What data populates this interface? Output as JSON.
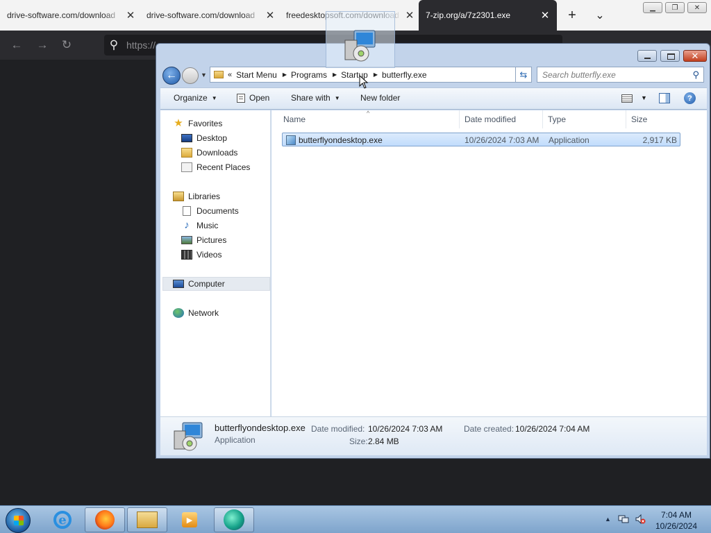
{
  "browser": {
    "tabs": [
      {
        "title": "drive-software.com/download",
        "active": false
      },
      {
        "title": "drive-software.com/download",
        "active": false
      },
      {
        "title": "freedesktopsoft.com/download",
        "active": false
      },
      {
        "title": "7-zip.org/a/7z2301.exe",
        "active": true
      }
    ],
    "new_tab_glyph": "+",
    "tab_list_glyph": "⌄",
    "url_partial": "https://",
    "icons": [
      "back-icon",
      "forward-icon",
      "reload-icon",
      "search-icon"
    ]
  },
  "explorer": {
    "address": {
      "overflow_glyph": "«",
      "crumbs": [
        "Start Menu",
        "Programs",
        "Startup",
        "butterfly.exe"
      ]
    },
    "search_placeholder": "Search butterfly.exe",
    "toolbar": {
      "organize": "Organize",
      "open": "Open",
      "share_with": "Share with",
      "new_folder": "New folder"
    },
    "nav": {
      "favorites": "Favorites",
      "desktop": "Desktop",
      "downloads": "Downloads",
      "recent_places": "Recent Places",
      "libraries": "Libraries",
      "documents": "Documents",
      "music": "Music",
      "pictures": "Pictures",
      "videos": "Videos",
      "computer": "Computer",
      "network": "Network"
    },
    "columns": {
      "name": "Name",
      "date_modified": "Date modified",
      "type": "Type",
      "size": "Size"
    },
    "files": [
      {
        "name": "butterflyondesktop.exe",
        "date_modified": "10/26/2024 7:03 AM",
        "type": "Application",
        "size": "2,917 KB",
        "selected": true
      }
    ],
    "details": {
      "name": "butterflyondesktop.exe",
      "type": "Application",
      "date_modified_label": "Date modified:",
      "date_modified": "10/26/2024 7:03 AM",
      "date_created_label": "Date created:",
      "date_created": "10/26/2024 7:04 AM",
      "size_label": "Size:",
      "size": "2.84 MB"
    }
  },
  "taskbar": {
    "pinned": [
      "internet-explorer-icon",
      "firefox-icon",
      "windows-explorer-icon",
      "media-player-icon",
      "app-icon"
    ],
    "clock": {
      "time": "7:04 AM",
      "date": "10/26/2024"
    }
  },
  "colors": {
    "selection": "#c1dcfc",
    "window_frame": "#c2d3ea",
    "taskbar": "#7ea4cc",
    "browser_dark": "#2b2b2f"
  }
}
